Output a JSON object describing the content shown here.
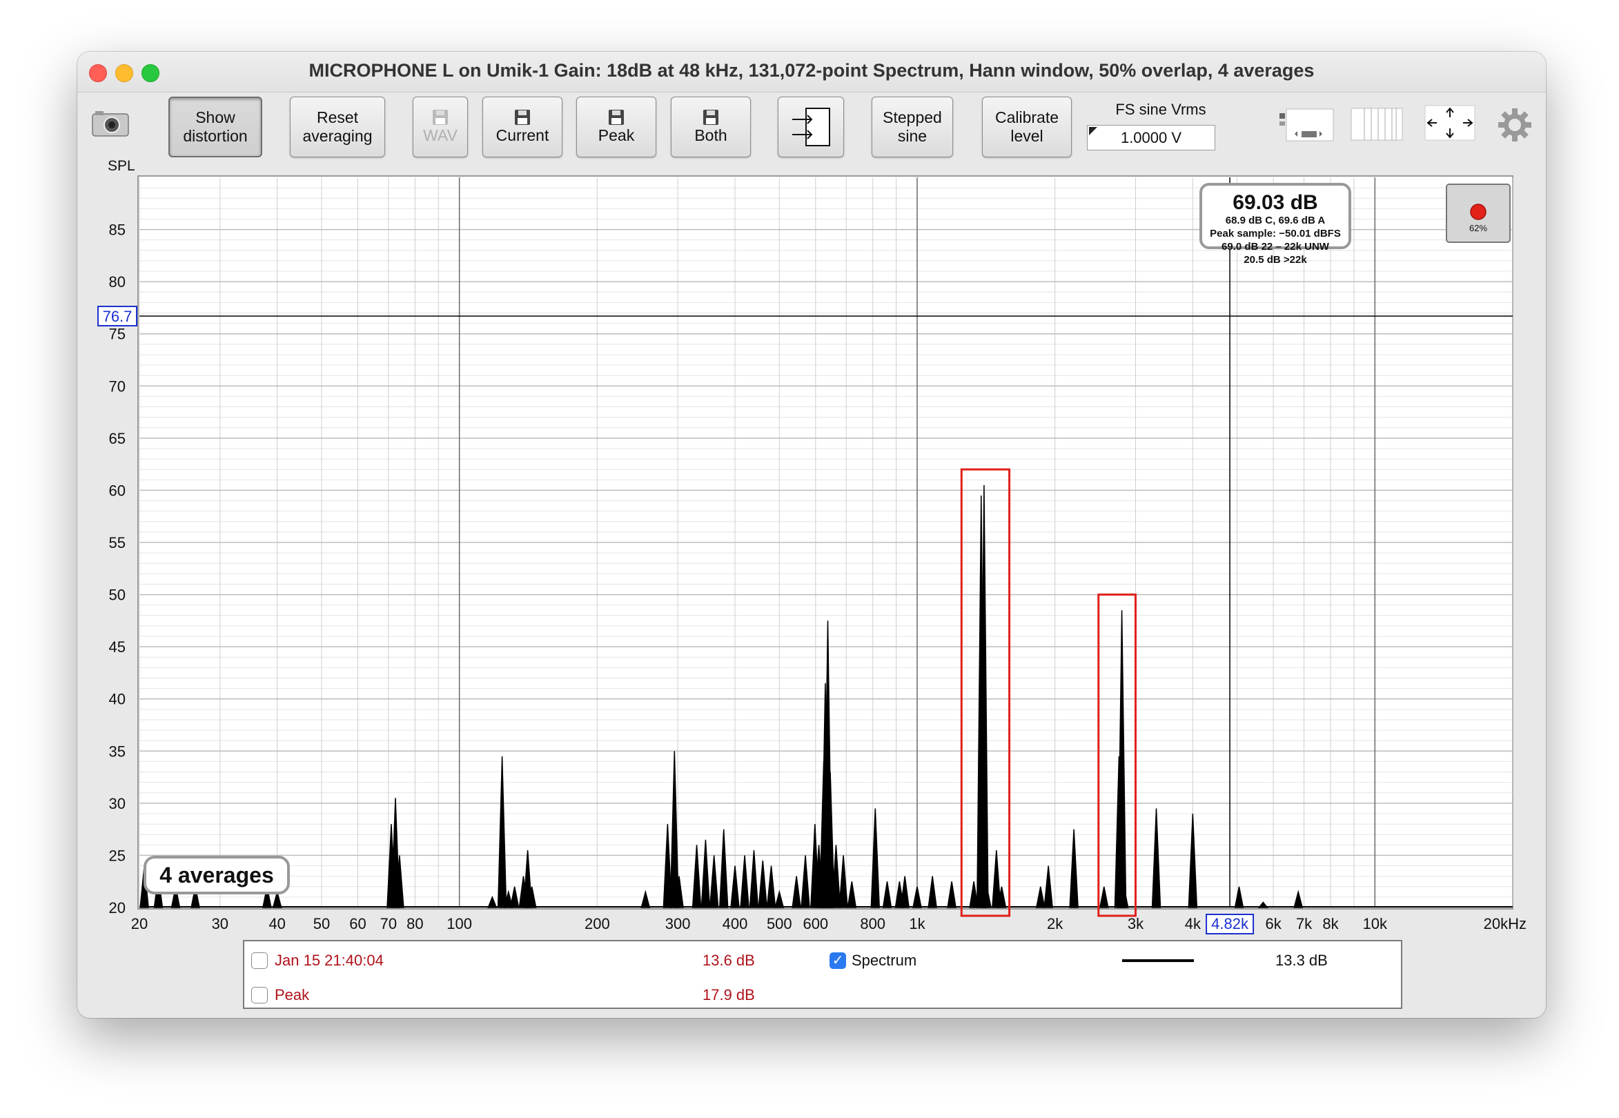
{
  "window": {
    "title": "MICROPHONE L on Umik-1  Gain: 18dB   at 48 kHz, 131,072-point Spectrum, Hann window, 50% overlap, 4 averages"
  },
  "toolbar": {
    "show_distortion": [
      "Show",
      "distortion"
    ],
    "reset_averaging": [
      "Reset",
      "averaging"
    ],
    "wav": "WAV",
    "current": "Current",
    "peak": "Peak",
    "both": "Both",
    "stepped_sine": [
      "Stepped",
      "sine"
    ],
    "calibrate_level": [
      "Calibrate",
      "level"
    ],
    "fs_label": "FS sine Vrms",
    "fs_value": "1.0000 V"
  },
  "icons": [
    "camera-icon",
    "floppy-disk-icon",
    "import-arrows-icon",
    "layout-rows-icon",
    "layout-columns-icon",
    "move-arrows-icon",
    "gear-icon",
    "record-led-icon"
  ],
  "plot": {
    "y_axis_label": "SPL",
    "cursor_y_value": "76.7",
    "cursor_x_value": "4.82k",
    "level_indicator": "62%",
    "averages_badge": "4 averages",
    "readout": {
      "main": "69.03 dB",
      "line1": "68.9 dB C, 69.6 dB A",
      "line2": "Peak sample: −50.01 dBFS",
      "line3": "69.0 dB 22 – 22k UNW",
      "line4": "20.5 dB >22k"
    }
  },
  "chart_data": {
    "type": "line",
    "title": "",
    "xlabel": "",
    "ylabel": "SPL",
    "x_scale": "log",
    "xlim": [
      20,
      20000
    ],
    "ylim": [
      20,
      90
    ],
    "y_ticks": [
      20,
      25,
      30,
      35,
      40,
      45,
      50,
      55,
      60,
      65,
      70,
      75,
      80,
      85
    ],
    "x_ticks": [
      {
        "v": 20,
        "label": "20"
      },
      {
        "v": 30,
        "label": "30"
      },
      {
        "v": 40,
        "label": "40"
      },
      {
        "v": 50,
        "label": "50"
      },
      {
        "v": 60,
        "label": "60"
      },
      {
        "v": 70,
        "label": "70"
      },
      {
        "v": 80,
        "label": "80"
      },
      {
        "v": 100,
        "label": "100"
      },
      {
        "v": 200,
        "label": "200"
      },
      {
        "v": 300,
        "label": "300"
      },
      {
        "v": 400,
        "label": "400"
      },
      {
        "v": 500,
        "label": "500"
      },
      {
        "v": 600,
        "label": "600"
      },
      {
        "v": 800,
        "label": "800"
      },
      {
        "v": 1000,
        "label": "1k"
      },
      {
        "v": 2000,
        "label": "2k"
      },
      {
        "v": 3000,
        "label": "3k"
      },
      {
        "v": 4000,
        "label": "4k"
      },
      {
        "v": 6000,
        "label": "6k"
      },
      {
        "v": 7000,
        "label": "7k"
      },
      {
        "v": 8000,
        "label": "8k"
      },
      {
        "v": 10000,
        "label": "10k"
      },
      {
        "v": 20000,
        "label": "20kHz"
      }
    ],
    "cursor": {
      "x": 4820,
      "y": 76.7
    },
    "series": [
      {
        "name": "Spectrum",
        "color": "#000000",
        "peaks": [
          {
            "f": 20.5,
            "db": 24
          },
          {
            "f": 22,
            "db": 23
          },
          {
            "f": 24,
            "db": 22
          },
          {
            "f": 26.5,
            "db": 22
          },
          {
            "f": 38,
            "db": 22
          },
          {
            "f": 40,
            "db": 21.5
          },
          {
            "f": 71,
            "db": 28
          },
          {
            "f": 72.5,
            "db": 30.5
          },
          {
            "f": 74,
            "db": 25
          },
          {
            "f": 118,
            "db": 21
          },
          {
            "f": 124,
            "db": 34.5
          },
          {
            "f": 128,
            "db": 21.5
          },
          {
            "f": 132,
            "db": 22
          },
          {
            "f": 138,
            "db": 23
          },
          {
            "f": 141,
            "db": 25.5
          },
          {
            "f": 144,
            "db": 22
          },
          {
            "f": 255,
            "db": 21.5
          },
          {
            "f": 285,
            "db": 28
          },
          {
            "f": 295,
            "db": 35
          },
          {
            "f": 302,
            "db": 23
          },
          {
            "f": 330,
            "db": 26
          },
          {
            "f": 345,
            "db": 26.5
          },
          {
            "f": 360,
            "db": 25
          },
          {
            "f": 378,
            "db": 27.5
          },
          {
            "f": 400,
            "db": 24
          },
          {
            "f": 420,
            "db": 25
          },
          {
            "f": 440,
            "db": 25.5
          },
          {
            "f": 460,
            "db": 24.5
          },
          {
            "f": 480,
            "db": 24
          },
          {
            "f": 500,
            "db": 21.5
          },
          {
            "f": 545,
            "db": 23
          },
          {
            "f": 570,
            "db": 25
          },
          {
            "f": 598,
            "db": 28
          },
          {
            "f": 610,
            "db": 26
          },
          {
            "f": 625,
            "db": 34
          },
          {
            "f": 630,
            "db": 41.5
          },
          {
            "f": 638,
            "db": 47.5
          },
          {
            "f": 646,
            "db": 33
          },
          {
            "f": 665,
            "db": 26
          },
          {
            "f": 690,
            "db": 25
          },
          {
            "f": 720,
            "db": 22.5
          },
          {
            "f": 810,
            "db": 29.5
          },
          {
            "f": 860,
            "db": 22.5
          },
          {
            "f": 915,
            "db": 22.5
          },
          {
            "f": 940,
            "db": 23
          },
          {
            "f": 1000,
            "db": 22
          },
          {
            "f": 1080,
            "db": 23
          },
          {
            "f": 1190,
            "db": 22.5
          },
          {
            "f": 1330,
            "db": 22.5
          },
          {
            "f": 1380,
            "db": 59.5
          },
          {
            "f": 1400,
            "db": 60.5
          },
          {
            "f": 1420,
            "db": 22
          },
          {
            "f": 1490,
            "db": 25.5
          },
          {
            "f": 1530,
            "db": 22
          },
          {
            "f": 1860,
            "db": 22
          },
          {
            "f": 1935,
            "db": 24
          },
          {
            "f": 2200,
            "db": 27.5
          },
          {
            "f": 2560,
            "db": 22
          },
          {
            "f": 2760,
            "db": 34.5
          },
          {
            "f": 2800,
            "db": 48.5
          },
          {
            "f": 2830,
            "db": 22
          },
          {
            "f": 3330,
            "db": 29.5
          },
          {
            "f": 4000,
            "db": 29
          },
          {
            "f": 5050,
            "db": 22
          },
          {
            "f": 5700,
            "db": 20.5
          },
          {
            "f": 6800,
            "db": 21.5
          }
        ]
      }
    ],
    "highlight_boxes": [
      {
        "f_min": 1250,
        "f_max": 1590,
        "db_min": 19,
        "db_max": 62
      },
      {
        "f_min": 2490,
        "f_max": 3000,
        "db_min": 19,
        "db_max": 50
      }
    ]
  },
  "legend": {
    "rows": [
      {
        "checked": false,
        "name": "Jan 15 21:40:04",
        "value": "13.6 dB",
        "color": "#b0121b"
      },
      {
        "checked": false,
        "name": "Peak",
        "value": "17.9 dB",
        "color": "#b0121b"
      }
    ],
    "spectrum": {
      "checked": true,
      "name": "Spectrum",
      "value": "13.3 dB",
      "color": "#000000"
    }
  }
}
